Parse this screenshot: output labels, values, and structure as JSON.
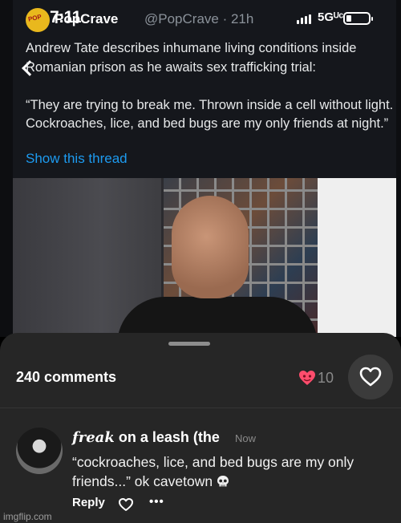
{
  "status_bar": {
    "time": "7:11",
    "network": "5G",
    "network_suffix": "ᵁᶜ"
  },
  "tweet": {
    "account_logo": "POP",
    "name": "PopCrave",
    "handle": "@PopCrave",
    "age": "21h",
    "headline": "Andrew Tate describes inhumane living conditions inside Romanian prison as he awaits sex trafficking trial:",
    "quote": "“They are trying to break me. Thrown inside a cell without light. Cockroaches, lice, and bed bugs are my only friends at night.”",
    "thread_link": "Show this thread"
  },
  "comments_sheet": {
    "count_label": "240 comments",
    "post_likes": "10",
    "comment": {
      "user_fancy": "𝒇𝒓𝒆𝒂𝒌",
      "user_rest": " on a leash (the",
      "time": "Now",
      "text": "“cockroaches, lice, and bed bugs are my only friends...” ok cavetown",
      "emoji": "skull-icon",
      "reply_label": "Reply",
      "more_label": "•••"
    }
  },
  "watermark": "imgflip.com",
  "colors": {
    "accent_heart": "#ff4d6d",
    "link_blue": "#1d9bf0",
    "sheet_bg": "#262626"
  }
}
